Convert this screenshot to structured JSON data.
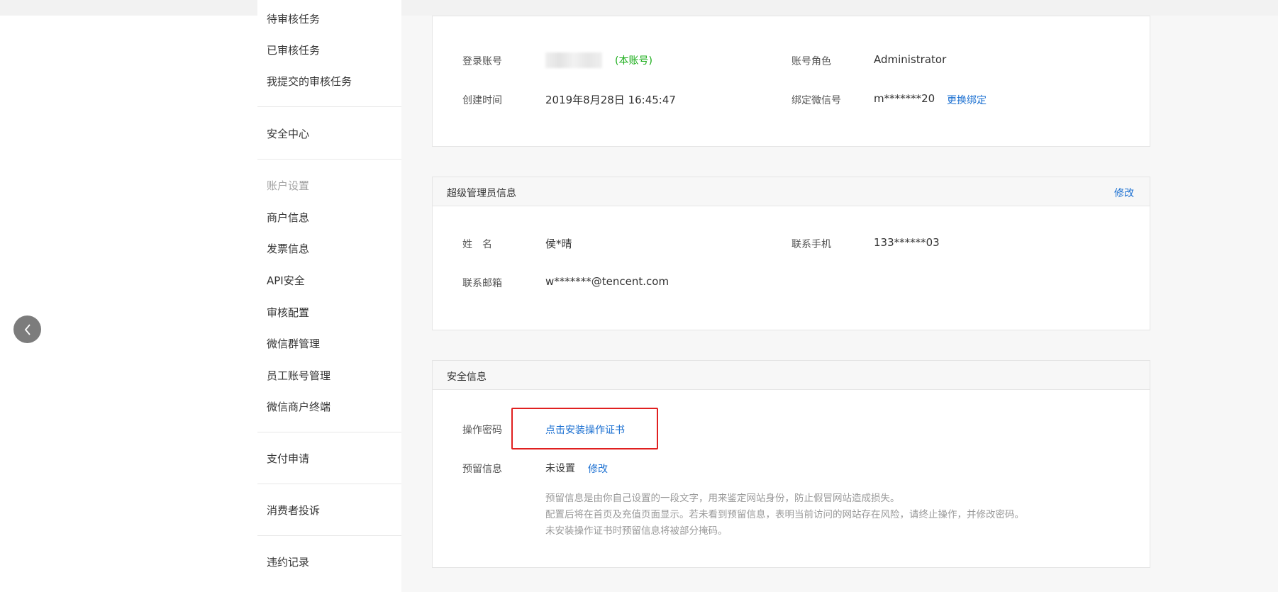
{
  "sidebar": {
    "items_top": [
      {
        "label": "待审核任务"
      },
      {
        "label": "已审核任务"
      },
      {
        "label": "我提交的审核任务"
      }
    ],
    "security_center": "安全中心",
    "account_group": "账户设置",
    "account_items": [
      {
        "label": "商户信息"
      },
      {
        "label": "发票信息"
      },
      {
        "label": "API安全"
      },
      {
        "label": "审核配置"
      },
      {
        "label": "微信群管理"
      },
      {
        "label": "员工账号管理"
      },
      {
        "label": "微信商户终端"
      }
    ],
    "pay_apply": "支付申请",
    "complaints": "消费者投诉",
    "violations": "违约记录"
  },
  "account_card": {
    "login_label": "登录账号",
    "login_note": "(本账号)",
    "role_label": "账号角色",
    "role_value": "Administrator",
    "created_label": "创建时间",
    "created_value": "2019年8月28日 16:45:47",
    "wechat_label": "绑定微信号",
    "wechat_value": "m*******20",
    "wechat_action": "更换绑定"
  },
  "admin_card": {
    "title": "超级管理员信息",
    "action": "修改",
    "name_label": "姓　名",
    "name_value": "侯*晴",
    "phone_label": "联系手机",
    "phone_value": "133******03",
    "email_label": "联系邮箱",
    "email_value": "w*******@tencent.com"
  },
  "security_card": {
    "title": "安全信息",
    "pwd_label": "操作密码",
    "pwd_action": "点击安装操作证书",
    "reserve_label": "预留信息",
    "reserve_value": "未设置",
    "reserve_action": "修改",
    "hints": [
      "预留信息是由你自己设置的一段文字，用来鉴定网站身份，防止假冒网站造成损失。",
      "配置后将在首页及充值页面显示。若未看到预留信息，表明当前访问的网站存在风险，请终止操作，并修改密码。",
      "未安装操作证书时预留信息将被部分掩码。"
    ]
  }
}
